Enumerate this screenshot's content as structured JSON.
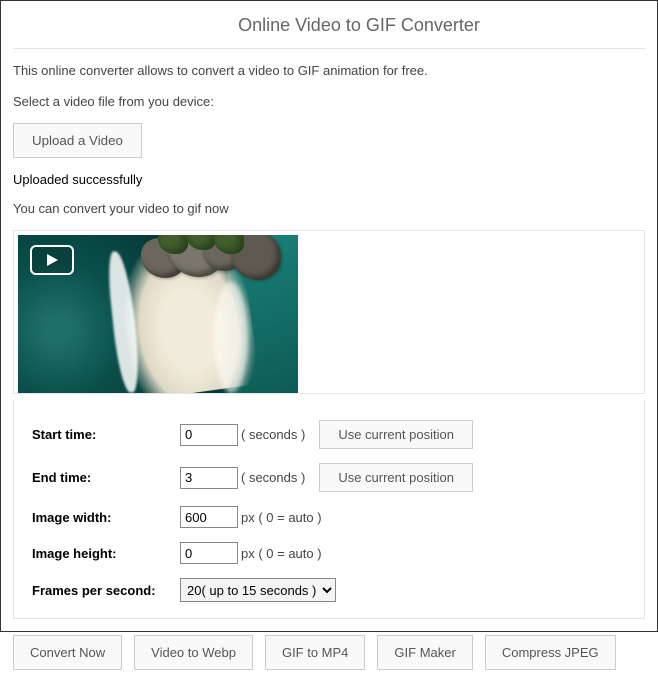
{
  "title": "Online Video to GIF Converter",
  "description": "This online converter allows to convert a video to GIF animation for free.",
  "select_label": "Select a video file from you device:",
  "upload_button": "Upload a Video",
  "upload_status": "Uploaded successfully",
  "convert_msg": "You can convert your video to gif now",
  "settings": {
    "start_time": {
      "label": "Start time:",
      "value": "0",
      "unit": "( seconds )",
      "button": "Use current position"
    },
    "end_time": {
      "label": "End time:",
      "value": "3",
      "unit": "( seconds )",
      "button": "Use current position"
    },
    "image_width": {
      "label": "Image width:",
      "value": "600",
      "unit": "px ( 0 = auto )"
    },
    "image_height": {
      "label": "Image height:",
      "value": "0",
      "unit": "px ( 0 = auto )"
    },
    "fps": {
      "label": "Frames per second:",
      "selected": "20( up to 15 seconds )"
    }
  },
  "actions": {
    "convert": "Convert Now",
    "webp": "Video to Webp",
    "gif2mp4": "GIF to MP4",
    "gifmaker": "GIF Maker",
    "compress": "Compress JPEG"
  }
}
